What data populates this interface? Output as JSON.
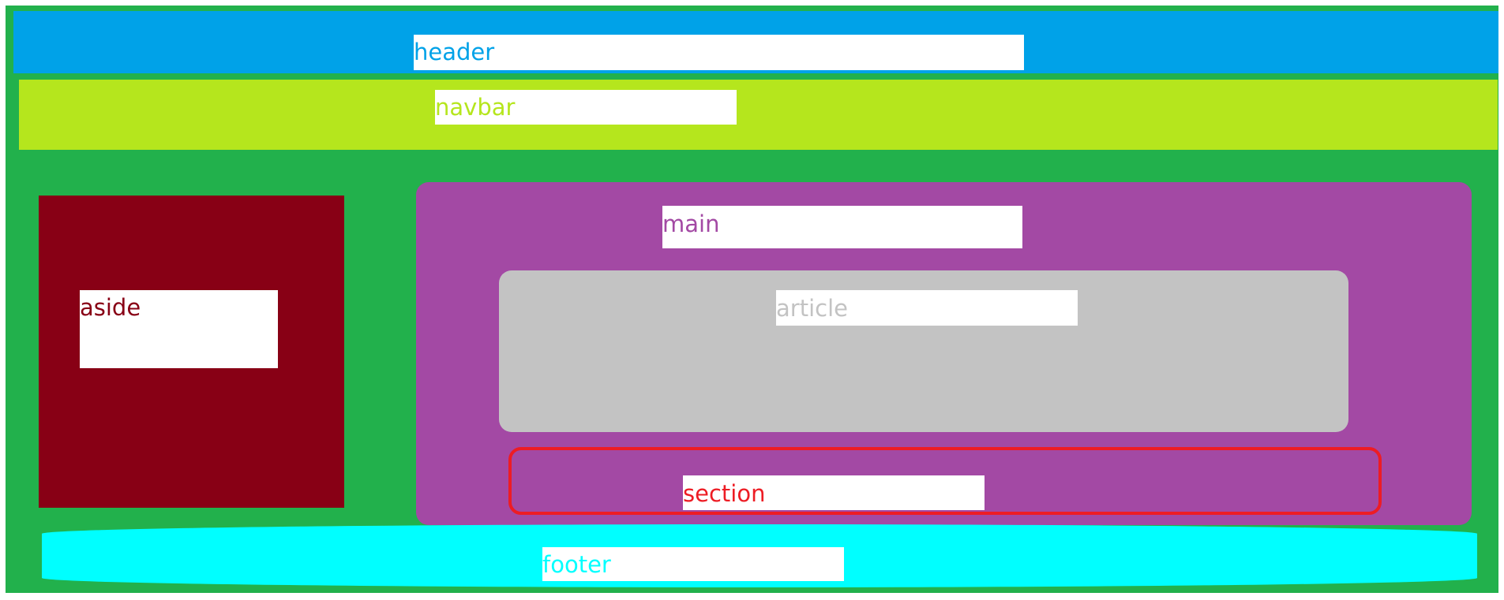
{
  "diagram": {
    "colors": {
      "page": "#22b14c",
      "header": "#00a2e8",
      "navbar": "#b5e61d",
      "aside": "#880015",
      "main": "#a349a4",
      "article": "#c3c3c3",
      "section_border": "#ed1c24",
      "footer": "#00ffff",
      "label_background": "#ffffff"
    },
    "header": {
      "label": "header"
    },
    "navbar": {
      "label": "navbar"
    },
    "aside": {
      "label": "aside"
    },
    "main": {
      "label": "main"
    },
    "article": {
      "label": "article"
    },
    "section": {
      "label": "section"
    },
    "footer": {
      "label": "footer"
    }
  }
}
